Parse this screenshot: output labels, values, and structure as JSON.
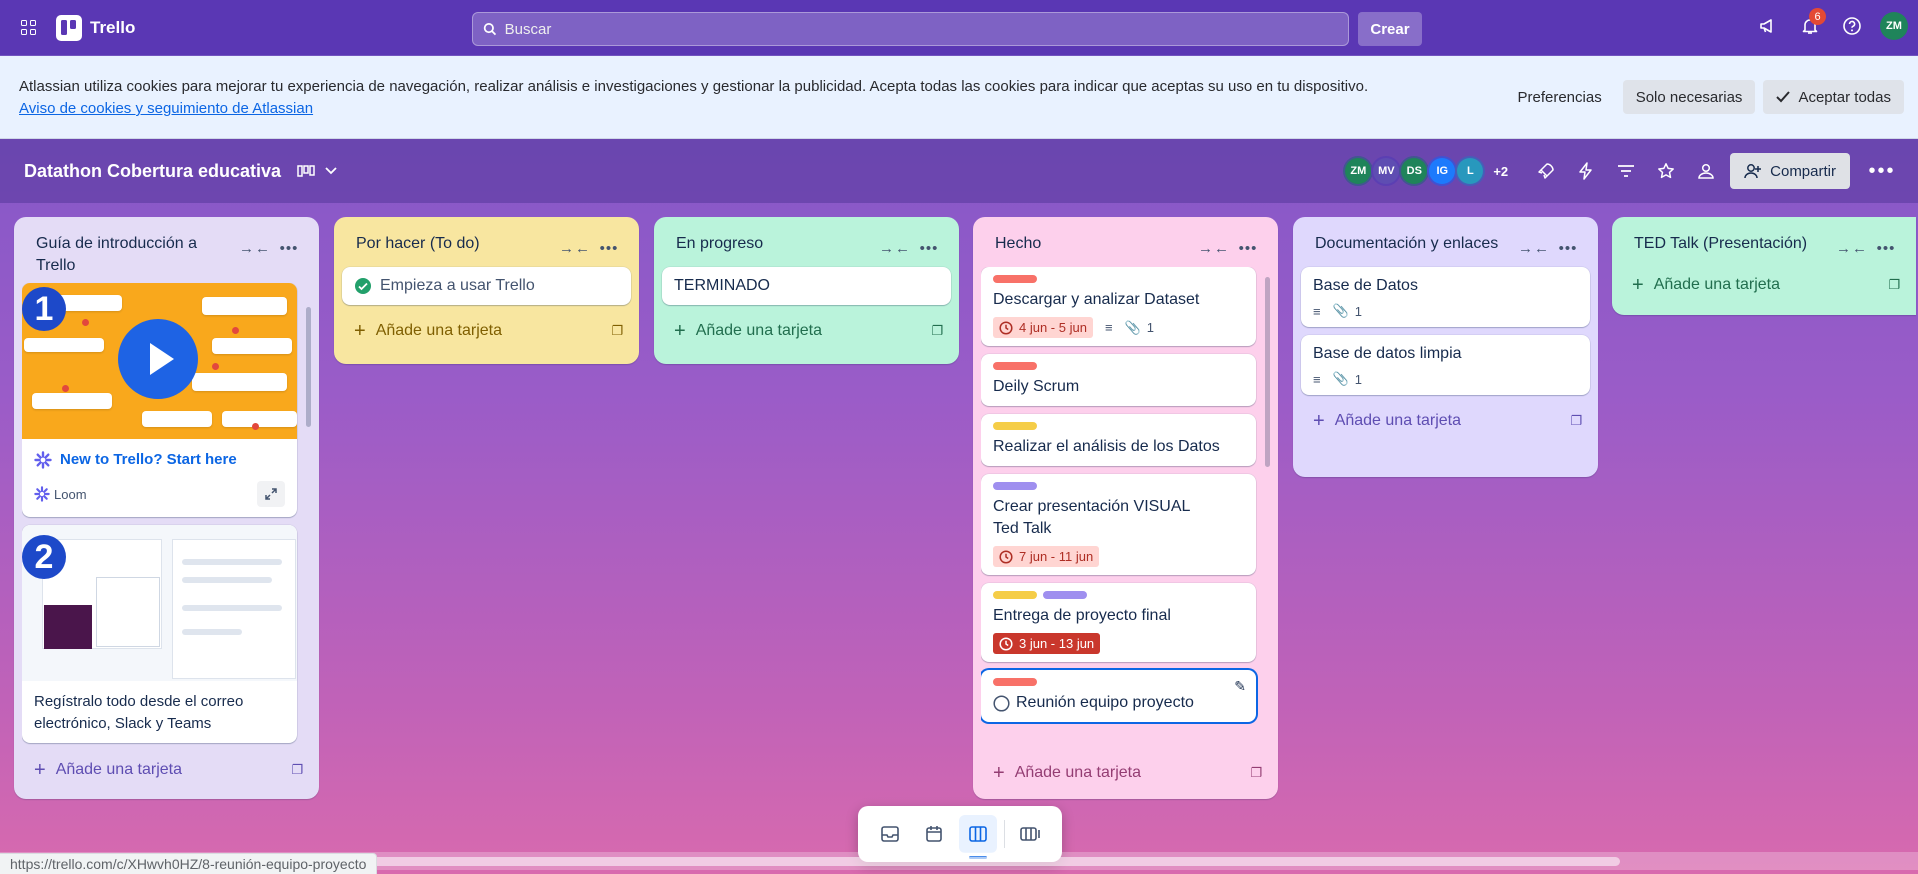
{
  "topbar": {
    "app_name": "Trello",
    "search_placeholder": "Buscar",
    "create_label": "Crear",
    "notification_count": "6",
    "user_initials": "ZM",
    "user_color": "#1f845a"
  },
  "cookie_banner": {
    "text": "Atlassian utiliza cookies para mejorar tu experiencia de navegación, realizar análisis e investigaciones y gestionar la publicidad. Acepta todas las cookies para indicar que aceptas su uso en tu dispositivo.",
    "link": "Aviso de cookies y seguimiento de Atlassian",
    "preferences_label": "Preferencias",
    "necessary_label": "Solo necesarias",
    "accept_label": "Aceptar todas"
  },
  "board": {
    "title": "Datathon Cobertura educativa",
    "members": [
      {
        "initials": "ZM",
        "color": "#1f845a"
      },
      {
        "initials": "MV",
        "color": "#5e4db2"
      },
      {
        "initials": "DS",
        "color": "#1f845a"
      },
      {
        "initials": "IG",
        "color": "#1d7afc"
      },
      {
        "initials": "L",
        "color": "#2898bd"
      }
    ],
    "more_members": "+2",
    "share_label": "Compartir"
  },
  "lists": [
    {
      "title": "Guía de introducción a Trello",
      "color": "#e4dcf6",
      "add_card": "Añade una tarjeta",
      "cards": [
        {
          "title": "New to Trello? Start here",
          "source": "Loom",
          "step": "1"
        },
        {
          "title": "Regístralo todo desde el correo electrónico, Slack y Teams",
          "step": "2"
        }
      ]
    },
    {
      "title": "Por hacer (To do)",
      "color": "#f8e6a0",
      "add_card": "Añade una tarjeta",
      "cards": [
        {
          "title": "Empieza a usar Trello"
        }
      ]
    },
    {
      "title": "En progreso",
      "color": "#baf3db",
      "add_card": "Añade una tarjeta",
      "cards": [
        {
          "title": "TERMINADO"
        }
      ]
    },
    {
      "title": "Hecho",
      "color": "#fdd0ec",
      "add_card": "Añade una tarjeta",
      "cards": [
        {
          "title": "Descargar y analizar Dataset",
          "date": "4 jun - 5 jun",
          "attachments": "1"
        },
        {
          "title": "Deily Scrum"
        },
        {
          "title": "Realizar el análisis de los Datos"
        },
        {
          "title": "Crear presentación VISUAL Ted Talk",
          "date": "7 jun - 11 jun"
        },
        {
          "title": "Entrega de proyecto final",
          "date": "3 jun - 13 jun"
        },
        {
          "title": "Reunión equipo proyecto"
        }
      ]
    },
    {
      "title": "Documentación y enlaces",
      "color": "#dfd8fd",
      "add_card": "Añade una tarjeta",
      "cards": [
        {
          "title": "Base de Datos",
          "attachments": "1"
        },
        {
          "title": "Base de datos limpia",
          "attachments": "1"
        }
      ]
    },
    {
      "title": "TED Talk (Presentación)",
      "color": "#baf3db",
      "add_card": "Añade una tarjeta",
      "cards": []
    }
  ],
  "label_colors": {
    "red": "#f87168",
    "yellow": "#f5cd47",
    "purple": "#9f8fef"
  },
  "status_url": "https://trello.com/c/XHwvh0HZ/8-reunión-equipo-proyecto"
}
